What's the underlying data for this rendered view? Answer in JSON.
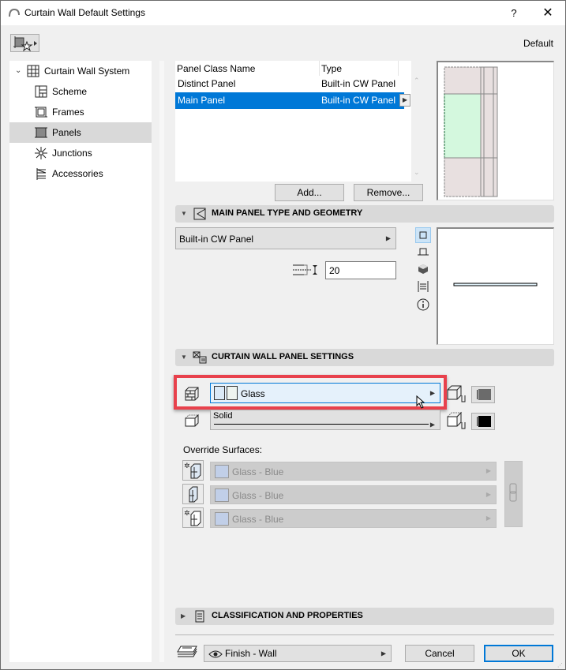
{
  "window": {
    "title": "Curtain Wall Default Settings",
    "help_label": "?",
    "close_label": "✕",
    "preset_label": "Default"
  },
  "sidebar": {
    "items": [
      {
        "label": "Curtain Wall System",
        "icon": "curtain-wall-grid-icon",
        "selected": false,
        "expanded": true
      },
      {
        "label": "Scheme",
        "icon": "scheme-icon",
        "selected": false
      },
      {
        "label": "Frames",
        "icon": "frames-icon",
        "selected": false
      },
      {
        "label": "Panels",
        "icon": "panels-icon",
        "selected": true
      },
      {
        "label": "Junctions",
        "icon": "junctions-icon",
        "selected": false
      },
      {
        "label": "Accessories",
        "icon": "accessories-icon",
        "selected": false
      }
    ]
  },
  "panel_list": {
    "columns": [
      "Panel Class Name",
      "Type"
    ],
    "rows": [
      {
        "name": "Distinct Panel",
        "type": "Built-in CW Panel",
        "selected": false
      },
      {
        "name": "Main Panel",
        "type": "Built-in CW Panel",
        "selected": true
      }
    ],
    "add_label": "Add...",
    "remove_label": "Remove..."
  },
  "sections": {
    "geometry": {
      "title": "MAIN PANEL TYPE AND GEOMETRY",
      "expanded": true,
      "panel_type": "Built-in CW Panel",
      "thickness": "20"
    },
    "panel_settings": {
      "title": "CURTAIN WALL PANEL SETTINGS",
      "expanded": true,
      "material": "Glass",
      "line_type": "Solid",
      "override_label": "Override Surfaces:",
      "overrides": [
        {
          "value": "Glass - Blue",
          "swatch": "#c1cfe8"
        },
        {
          "value": "Glass - Blue",
          "swatch": "#c1cfe8"
        },
        {
          "value": "Glass - Blue",
          "swatch": "#c1cfe8"
        }
      ]
    },
    "classification": {
      "title": "CLASSIFICATION AND PROPERTIES",
      "expanded": false
    }
  },
  "footer": {
    "layer": "Finish - Wall",
    "cancel_label": "Cancel",
    "ok_label": "OK"
  },
  "colors": {
    "selection": "#0078d7",
    "highlight_frame": "#e8414c",
    "panel_preview_fill": "#d4f8de",
    "frame_fill": "#e8e0e0"
  }
}
